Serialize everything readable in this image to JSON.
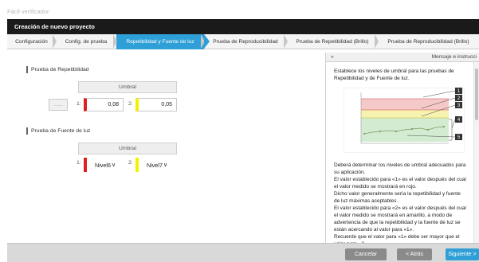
{
  "app": {
    "title": "Fácil verificador"
  },
  "wizard": {
    "title": "Creación de nuevo proyecto"
  },
  "tabs": [
    {
      "label": "Configuración"
    },
    {
      "label": "Config. de prueba"
    },
    {
      "label": "Repetibilidad y Fuente de luz",
      "active": true
    },
    {
      "label": "Prueba de Reproducibilidad"
    },
    {
      "label": "Prueba de Repetibilidad (Brillo)"
    },
    {
      "label": "Prueba de Reproducibilidad (Brillo)"
    }
  ],
  "repeat": {
    "title": "Prueba de Repetibilidad",
    "col_header": "Umbral",
    "dots": "......",
    "idx1": "1:",
    "idx2": "2:",
    "value1": "0,08",
    "value2": "0,05"
  },
  "light": {
    "title": "Prueba de Fuente de luz",
    "col_header": "Umbral",
    "idx1": "1:",
    "idx2": "2:",
    "level1": "Nivel6",
    "level2": "Nivel7"
  },
  "panel": {
    "expand": "»",
    "title": "Mensaje e instrucci",
    "intro": "Establece los niveles de umbral para las pruebas de Repetibilidad y de Fuente de luz.",
    "callouts": [
      "1",
      "2",
      "3",
      "4",
      "5"
    ],
    "body": [
      "Deberá determinar los niveles de umbral adecuados para su aplicación.",
      "El valor establecido para «1» es el valor después del cual el valor medido se mostrará en rojo.",
      "Dicho valor generalmente sería la repetibilidad y fuente de luz máximas aceptables.",
      "El valor establecido para «2» es el valor después del cual el valor medido se mostrará en amarillo, a modo de advertencia de que la repetibilidad y la fuente de luz se están acercando al valor para «1».",
      "Recuerde que el valor para «1» debe ser mayor que el valor para «2»."
    ]
  },
  "footer": {
    "cancel": "Cancelar",
    "back": "< Atrás",
    "next": "Siguiente >"
  },
  "colors": {
    "accent": "#2f9fd7",
    "threshold1": "#e02020",
    "threshold2": "#f2f200"
  }
}
